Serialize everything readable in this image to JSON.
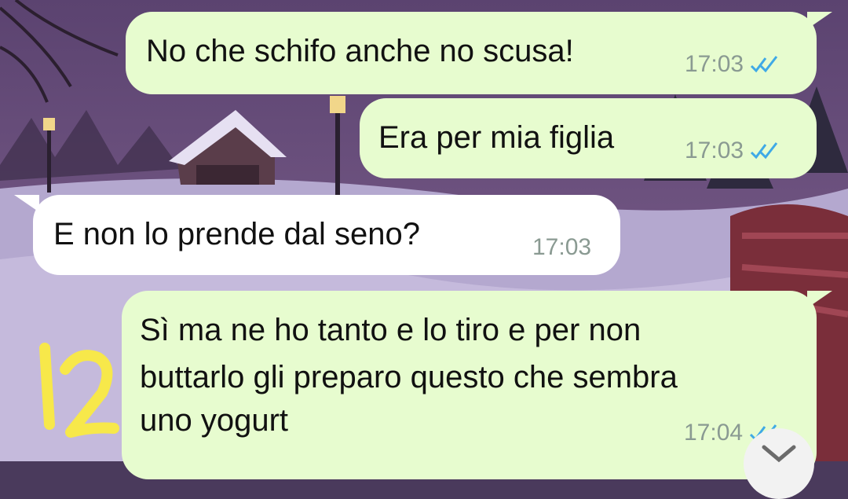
{
  "chat": {
    "messages": [
      {
        "direction": "outgoing",
        "text": "No che schifo anche no scusa!",
        "time": "17:03",
        "status": "read"
      },
      {
        "direction": "outgoing",
        "text": "Era per mia figlia",
        "time": "17:03",
        "status": "read"
      },
      {
        "direction": "incoming",
        "text": "E non lo prende dal seno?",
        "time": "17:03"
      },
      {
        "direction": "outgoing",
        "text_lines": [
          "Sì ma ne ho tanto e lo tiro e per non",
          "buttarlo gli preparo questo che sembra",
          "uno yogurt"
        ],
        "time": "17:04",
        "status": "read"
      }
    ]
  },
  "annotation": {
    "text": "12",
    "color": "#f7e84a"
  },
  "colors": {
    "outgoing_bubble": "#e7fccf",
    "incoming_bubble": "#ffffff",
    "read_ticks": "#3fa9e6",
    "timestamp": "#8a9a92"
  },
  "icons": {
    "read_receipt": "double-check-icon",
    "scroll_down": "chevron-down-icon"
  }
}
